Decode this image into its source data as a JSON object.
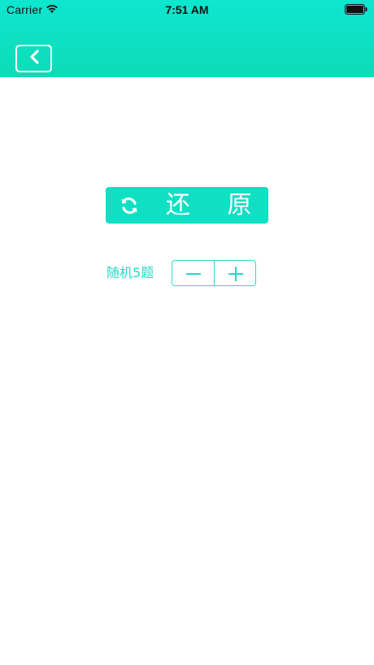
{
  "status_bar": {
    "carrier": "Carrier",
    "time": "7:51 AM"
  },
  "header": {
    "back_icon": "chevron-left-icon",
    "accent": "#0ee6cf"
  },
  "main": {
    "restore_button": {
      "label": "还 原",
      "icon": "refresh-icon"
    },
    "random_label": "随机5题",
    "stepper": {
      "decrement_icon": "minus-icon",
      "increment_icon": "plus-icon"
    }
  },
  "colors": {
    "accent": "#0fe0c4",
    "text_accent": "#27d8c8"
  }
}
